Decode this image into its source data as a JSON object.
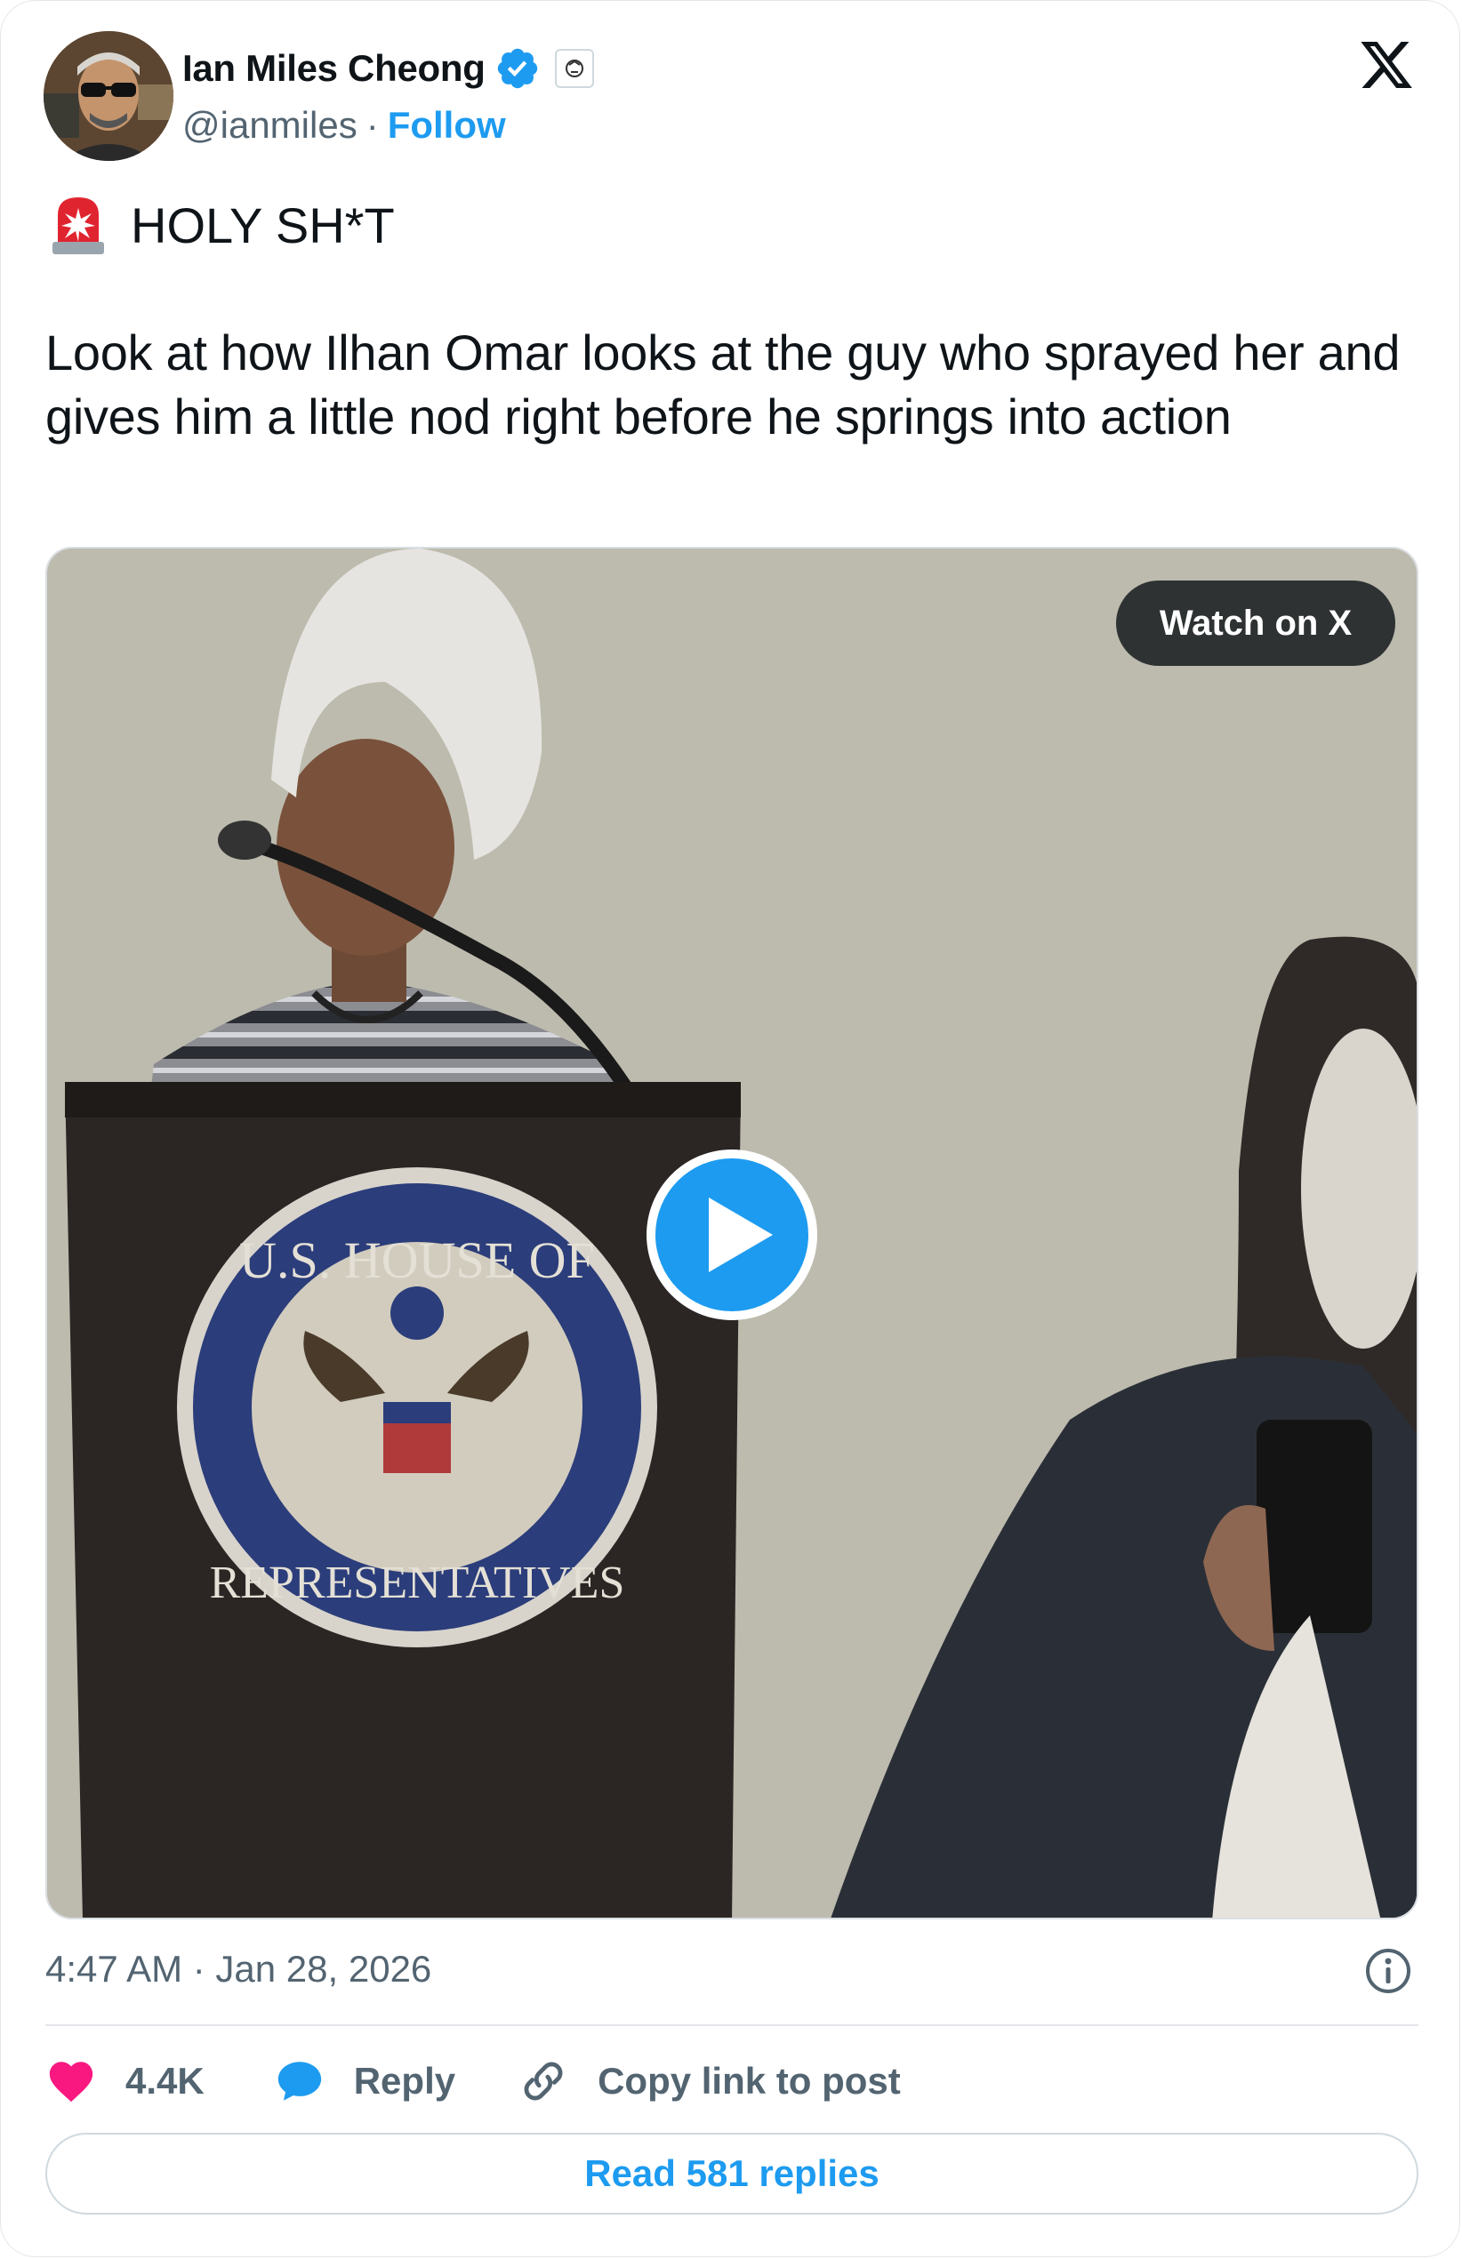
{
  "author": {
    "name": "Ian Miles Cheong",
    "handle": "@ianmiles",
    "separator": "·",
    "follow_label": "Follow",
    "verified_color": "#1d9bf0"
  },
  "post": {
    "headline": "HOLY SH*T",
    "body": "Look at how Ilhan Omar looks at the guy who sprayed her and gives him a little nod right before he springs into action",
    "timestamp": "4:47 AM · Jan 28, 2026"
  },
  "media": {
    "watch_label": "Watch on X",
    "seal_text_top": "U.S. HOUSE OF",
    "seal_text_bottom": "REPRESENTATIVES",
    "play_color": "#1d9bf0"
  },
  "actions": {
    "likes": "4.4K",
    "reply_label": "Reply",
    "copy_label": "Copy link to post",
    "read_replies_label": "Read 581 replies",
    "like_color": "#f91880"
  },
  "icons": [
    "x-logo-icon",
    "verified-badge-icon",
    "affiliate-badge-icon",
    "siren-icon",
    "play-icon",
    "info-icon",
    "heart-icon",
    "reply-bubble-icon",
    "link-icon"
  ]
}
